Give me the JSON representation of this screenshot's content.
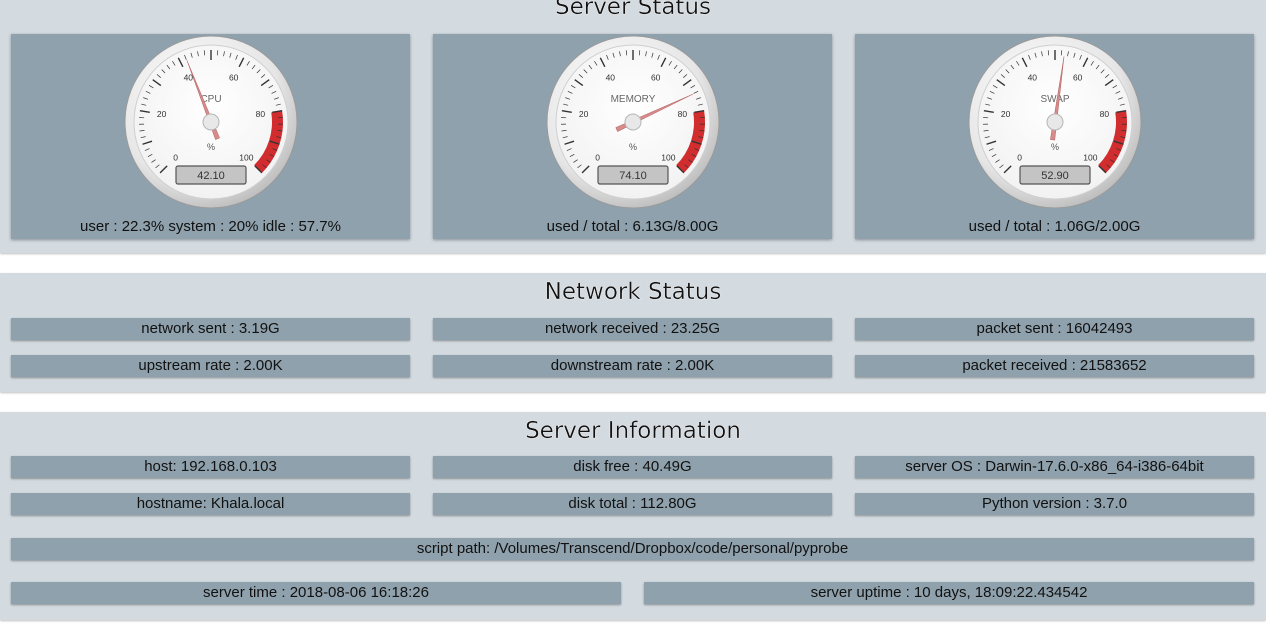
{
  "server_status": {
    "title": "Server Status",
    "gauges": [
      {
        "label": "CPU",
        "unit": "%",
        "value": 42.1,
        "display": "42.10",
        "caption": "user : 22.3% system : 20% idle : 57.7%"
      },
      {
        "label": "MEMORY",
        "unit": "%",
        "value": 74.1,
        "display": "74.10",
        "caption": "used / total : 6.13G/8.00G"
      },
      {
        "label": "SWAP",
        "unit": "%",
        "value": 52.9,
        "display": "52.90",
        "caption": "used / total : 1.06G/2.00G"
      }
    ],
    "scale": {
      "min": 0,
      "max": 100,
      "ticks": [
        "0",
        "20",
        "40",
        "60",
        "80",
        "100"
      ],
      "danger_from": 80
    }
  },
  "network_status": {
    "title": "Network Status",
    "network_sent": "network sent : 3.19G",
    "network_received": "network received : 23.25G",
    "packet_sent": "packet sent : 16042493",
    "upstream_rate": "upstream rate : 2.00K",
    "downstream_rate": "downstream rate : 2.00K",
    "packet_received": "packet received : 21583652"
  },
  "server_information": {
    "title": "Server Information",
    "host": "host: 192.168.0.103",
    "disk_free": "disk free : 40.49G",
    "server_os": "server OS : Darwin-17.6.0-x86_64-i386-64bit",
    "hostname": "hostname: Khala.local",
    "disk_total": "disk total : 112.80G",
    "python_version": "Python version : 3.7.0",
    "script_path": "script path: /Volumes/Transcend/Dropbox/code/personal/pyprobe",
    "server_time": "server time : 2018-08-06 16:18:26",
    "server_uptime": "server uptime : 10 days, 18:09:22.434542"
  },
  "colors": {
    "panel_bg": "#d3dae0",
    "card_bg": "#8fa1ac",
    "danger_band": "#d12d2f",
    "needle": "#d98a8a"
  }
}
